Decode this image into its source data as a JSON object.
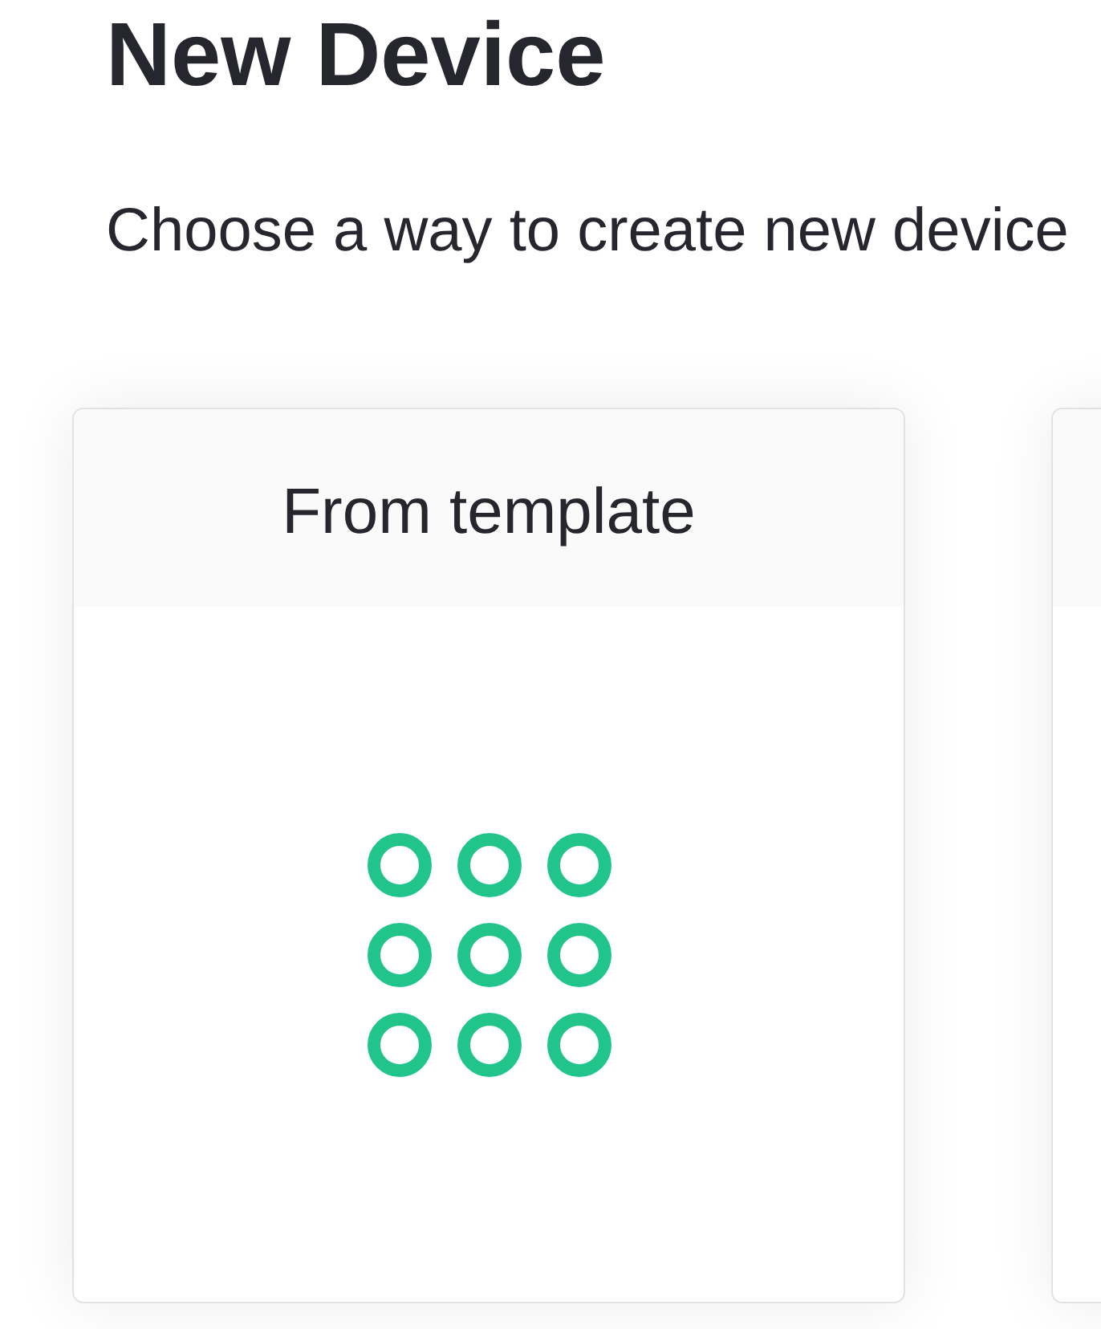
{
  "page": {
    "title": "New Device",
    "subtitle": "Choose a way to create new device"
  },
  "cards": [
    {
      "kind": "template",
      "title": "From template"
    },
    {
      "kind": "blank"
    }
  ]
}
